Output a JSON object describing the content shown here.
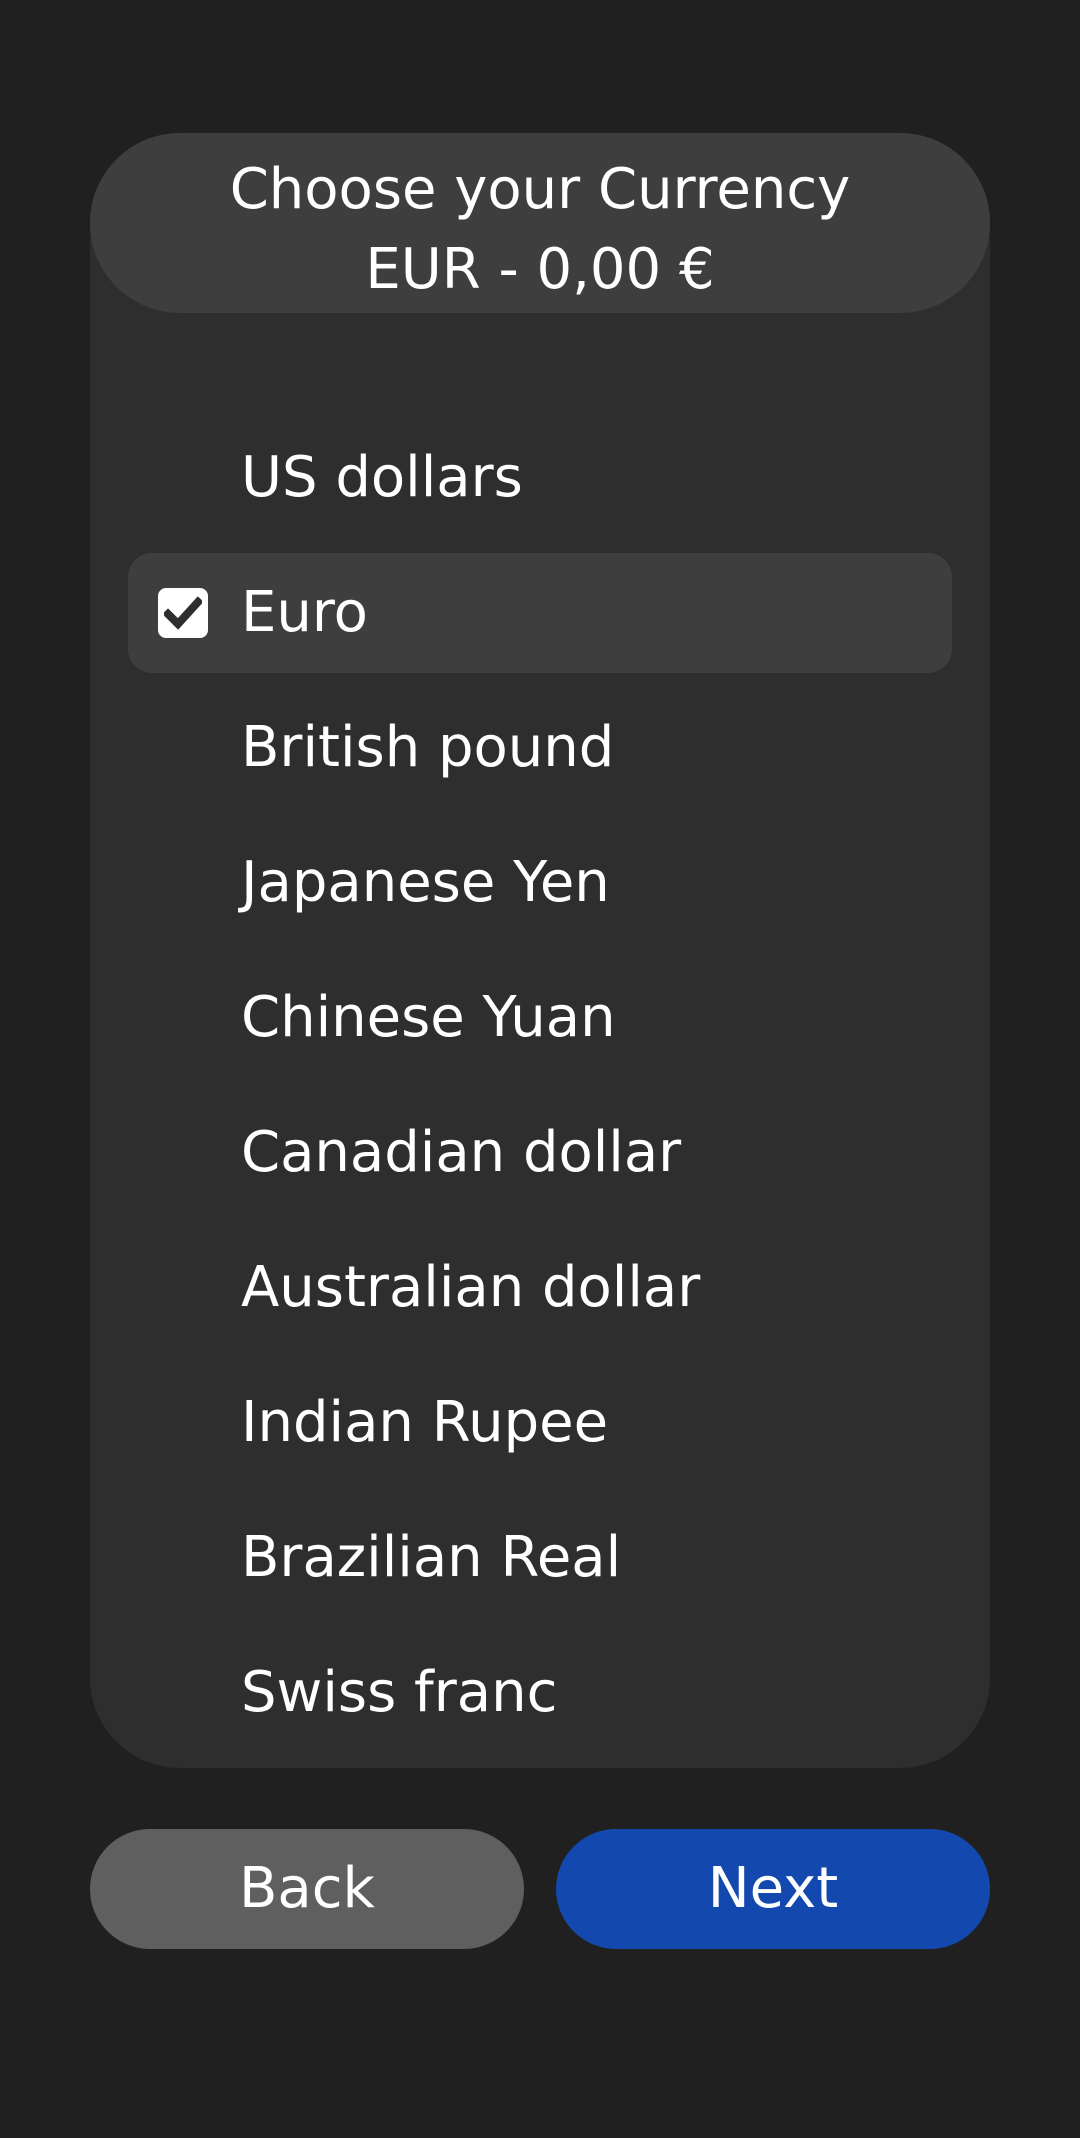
{
  "header": {
    "title": "Choose your Currency",
    "subtitle": "EUR - 0,00 €"
  },
  "currencies": [
    {
      "label": "US dollars",
      "selected": false
    },
    {
      "label": "Euro",
      "selected": true
    },
    {
      "label": "British pound",
      "selected": false
    },
    {
      "label": "Japanese Yen",
      "selected": false
    },
    {
      "label": "Chinese Yuan",
      "selected": false
    },
    {
      "label": "Canadian dollar",
      "selected": false
    },
    {
      "label": "Australian dollar",
      "selected": false
    },
    {
      "label": "Indian Rupee",
      "selected": false
    },
    {
      "label": "Brazilian Real",
      "selected": false
    },
    {
      "label": "Swiss franc",
      "selected": false
    }
  ],
  "buttons": {
    "back_label": "Back",
    "next_label": "Next"
  },
  "icons": {
    "checkbox": "checkmark-icon"
  },
  "colors": {
    "background": "#202020",
    "card": "#2e2e2f",
    "header": "#3e3e3e",
    "selected_row": "#3e3e3e",
    "back_button": "#5f5f5f",
    "next_button": "#1349ae"
  }
}
